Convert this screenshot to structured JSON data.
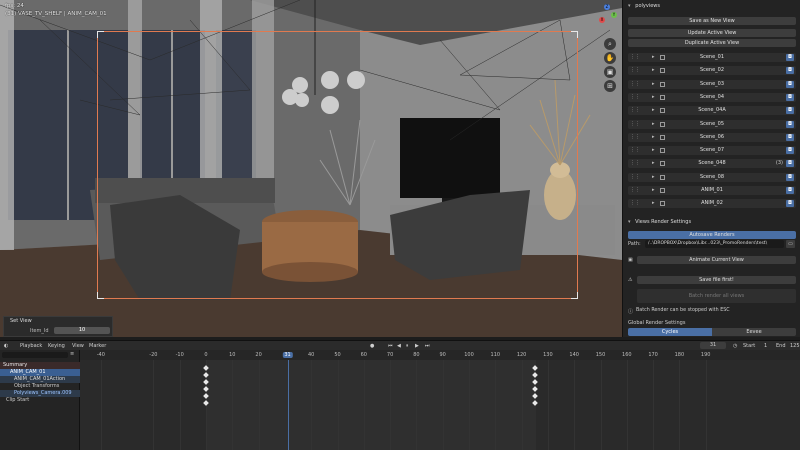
{
  "viewport": {
    "fps_label": "fps: 24",
    "object_label": "(31) VASE_TV_SHELF | ANIM_CAM_01",
    "set_view_title": "Set View",
    "item_id_label": "Item_Id",
    "item_id_value": "10",
    "axes": {
      "x": "X",
      "y": "Y",
      "z": "Z"
    }
  },
  "panel": {
    "title": "polyviews",
    "save_new_view": "Save as New View",
    "update_active_view": "Update Active View",
    "duplicate_active_view": "Duplicate Active View",
    "views": [
      {
        "label": "Scene_01",
        "num": ""
      },
      {
        "label": "Scene_02",
        "num": ""
      },
      {
        "label": "Scene_03",
        "num": ""
      },
      {
        "label": "Scene_04",
        "num": ""
      },
      {
        "label": "Scene_04A",
        "num": ""
      },
      {
        "label": "Scene_05",
        "num": ""
      },
      {
        "label": "Scene_06",
        "num": ""
      },
      {
        "label": "Scene_07",
        "num": ""
      },
      {
        "label": "Scene_048",
        "num": "(3)"
      },
      {
        "label": "Scene_08",
        "num": ""
      },
      {
        "label": "ANIM_01",
        "num": ""
      },
      {
        "label": "ANIM_02",
        "num": ""
      }
    ],
    "render_settings_title": "Views Render Settings",
    "autosave_renders": "Autosave Renders",
    "path_label": "Path:",
    "path_value": "/..\\DROPBOX\\Dropbox\\Libr...023\\_PromoRenders\\test\\",
    "animate_current_view": "Animate Current View",
    "save_file_first": "Save file first!",
    "batch_render": "Batch render all views",
    "esc_note": "Batch Render can be stopped with ESC",
    "global_render_title": "Global Render Settings",
    "engine_cycles": "Cycles",
    "engine_eevee": "Eevee"
  },
  "timeline": {
    "menus": [
      "Playback",
      "Keying",
      "View",
      "Marker"
    ],
    "current_frame": "31",
    "start_label": "Start",
    "start_value": "1",
    "end_label": "End",
    "end_value": "125",
    "ruler_ticks": [
      "-40",
      "-20",
      "-10",
      "0",
      "10",
      "20",
      "31",
      "40",
      "50",
      "60",
      "70",
      "80",
      "90",
      "100",
      "110",
      "120",
      "130",
      "140",
      "150",
      "160",
      "170",
      "180",
      "190"
    ],
    "tree": [
      "Summary",
      "ANIM_CAM_01",
      "ANIM_CAM_01Action",
      "Object Transforms",
      "Polyviews_Camera.009",
      "Clip Start"
    ]
  },
  "colors": {
    "accent_blue": "#4a6fa5",
    "frame_orange": "#e07a50",
    "active_blue": "#3a5f92"
  }
}
